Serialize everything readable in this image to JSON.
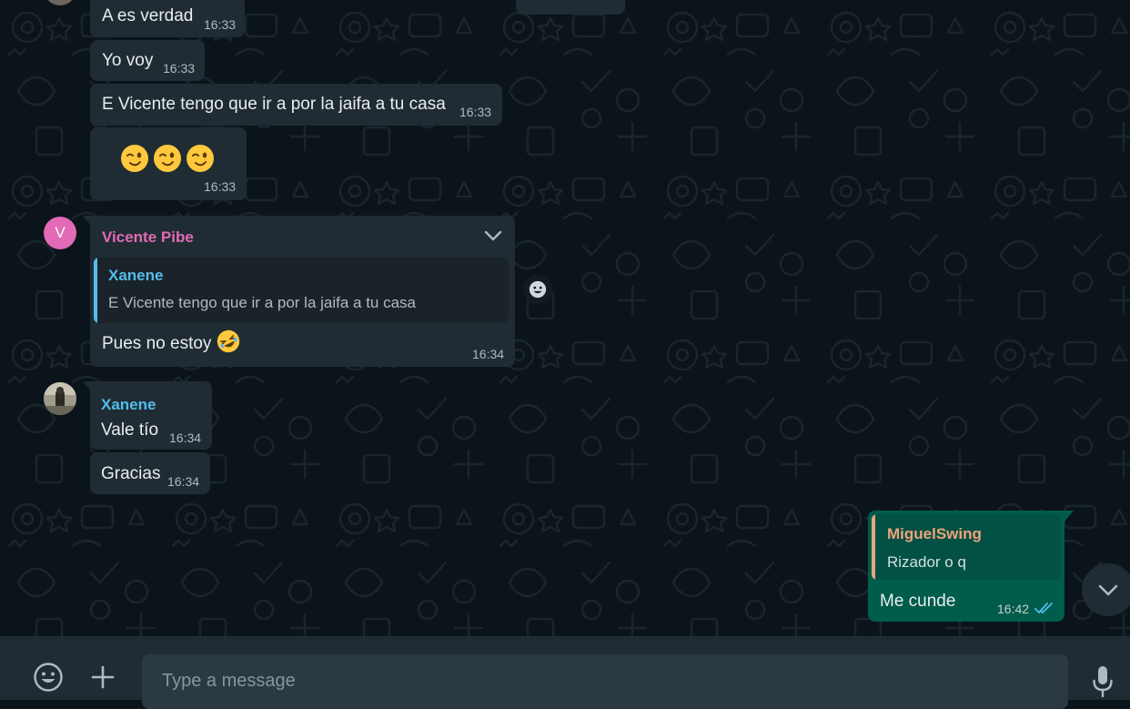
{
  "colors": {
    "incoming_bubble": "#202c33",
    "outgoing_bubble": "#005c4b",
    "sender_vicente": "#e26ab6",
    "sender_xanene": "#53bdeb",
    "sender_miguelswing": "#f0a37a",
    "read_ticks": "#53bdeb"
  },
  "messages": [
    {
      "text": "A es verdad",
      "time": "16:33"
    },
    {
      "text": "Yo voy",
      "time": "16:33"
    },
    {
      "text": "E Vicente tengo que ir a por la jaifa a tu casa",
      "time": "16:33"
    },
    {
      "emojis": [
        "wink-emoji",
        "wink-emoji",
        "wink-emoji"
      ],
      "time": "16:33"
    },
    {
      "avatar_letter": "V",
      "sender": "Vicente Pibe",
      "quote_author": "Xanene",
      "quote_text": "E Vicente tengo que ir a por la jaifa a tu casa",
      "text": "Pues no estoy",
      "emoji": "rofl-emoji",
      "time": "16:34"
    },
    {
      "sender": "Xanene",
      "text": "Vale tío",
      "time": "16:34"
    },
    {
      "text": "Gracias",
      "time": "16:34"
    },
    {
      "direction": "outgoing",
      "quote_author": "MiguelSwing",
      "quote_text": "Rizador o q",
      "text": "Me cunde",
      "time": "16:42",
      "status": "read"
    }
  ],
  "composer": {
    "placeholder": "Type a message",
    "emoji_icon": "smiley-icon",
    "attach_icon": "plus-icon",
    "voice_icon": "microphone-icon"
  },
  "scroll_down_icon": "chevron-down-icon"
}
